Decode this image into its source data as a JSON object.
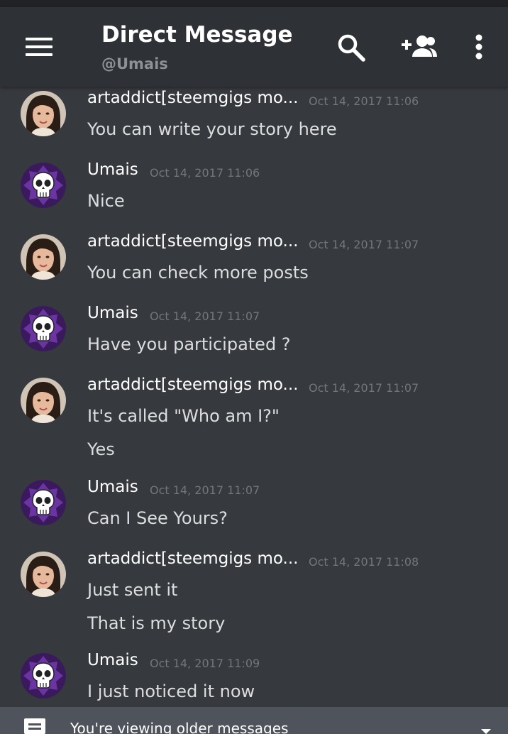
{
  "header": {
    "title": "Direct Message",
    "subtitle": "@Umais"
  },
  "icons": {
    "menu": "hamburger-menu-icon",
    "search": "search-icon",
    "add_user": "add-user-icon",
    "more": "more-vertical-icon"
  },
  "users": {
    "artaddict": {
      "name": "artaddict[steemgigs mo...",
      "avatar": "woman-photo-avatar"
    },
    "umais": {
      "name": "Umais",
      "avatar": "purple-skull-avatar"
    }
  },
  "messages": [
    {
      "author": "artaddict[steemgigs mo...",
      "time": "Oct 14, 2017 11:06",
      "lines": [
        "You can write your story here"
      ]
    },
    {
      "author": "Umais",
      "time": "Oct 14, 2017 11:06",
      "lines": [
        "Nice"
      ]
    },
    {
      "author": "artaddict[steemgigs mo...",
      "time": "Oct 14, 2017 11:07",
      "lines": [
        "You can check more posts"
      ]
    },
    {
      "author": "Umais",
      "time": "Oct 14, 2017 11:07",
      "lines": [
        "Have you participated ?"
      ]
    },
    {
      "author": "artaddict[steemgigs mo...",
      "time": "Oct 14, 2017 11:07",
      "lines": [
        "It's called \"Who am I?\"",
        "Yes"
      ]
    },
    {
      "author": "Umais",
      "time": "Oct 14, 2017 11:07",
      "lines": [
        "Can I See Yours?"
      ]
    },
    {
      "author": "artaddict[steemgigs mo...",
      "time": "Oct 14, 2017 11:08",
      "lines": [
        "Just sent it",
        "That is my story"
      ]
    },
    {
      "author": "Umais",
      "time": "Oct 14, 2017 11:09",
      "lines": [
        "I just noticed it now"
      ]
    }
  ],
  "older_banner": {
    "text": "You're viewing older messages"
  },
  "colors": {
    "background": "#36393e",
    "app_bar": "#2e3136",
    "banner": "#4f545c",
    "timestamp": "#72767d",
    "avatar_purple": "#5b2a86"
  }
}
